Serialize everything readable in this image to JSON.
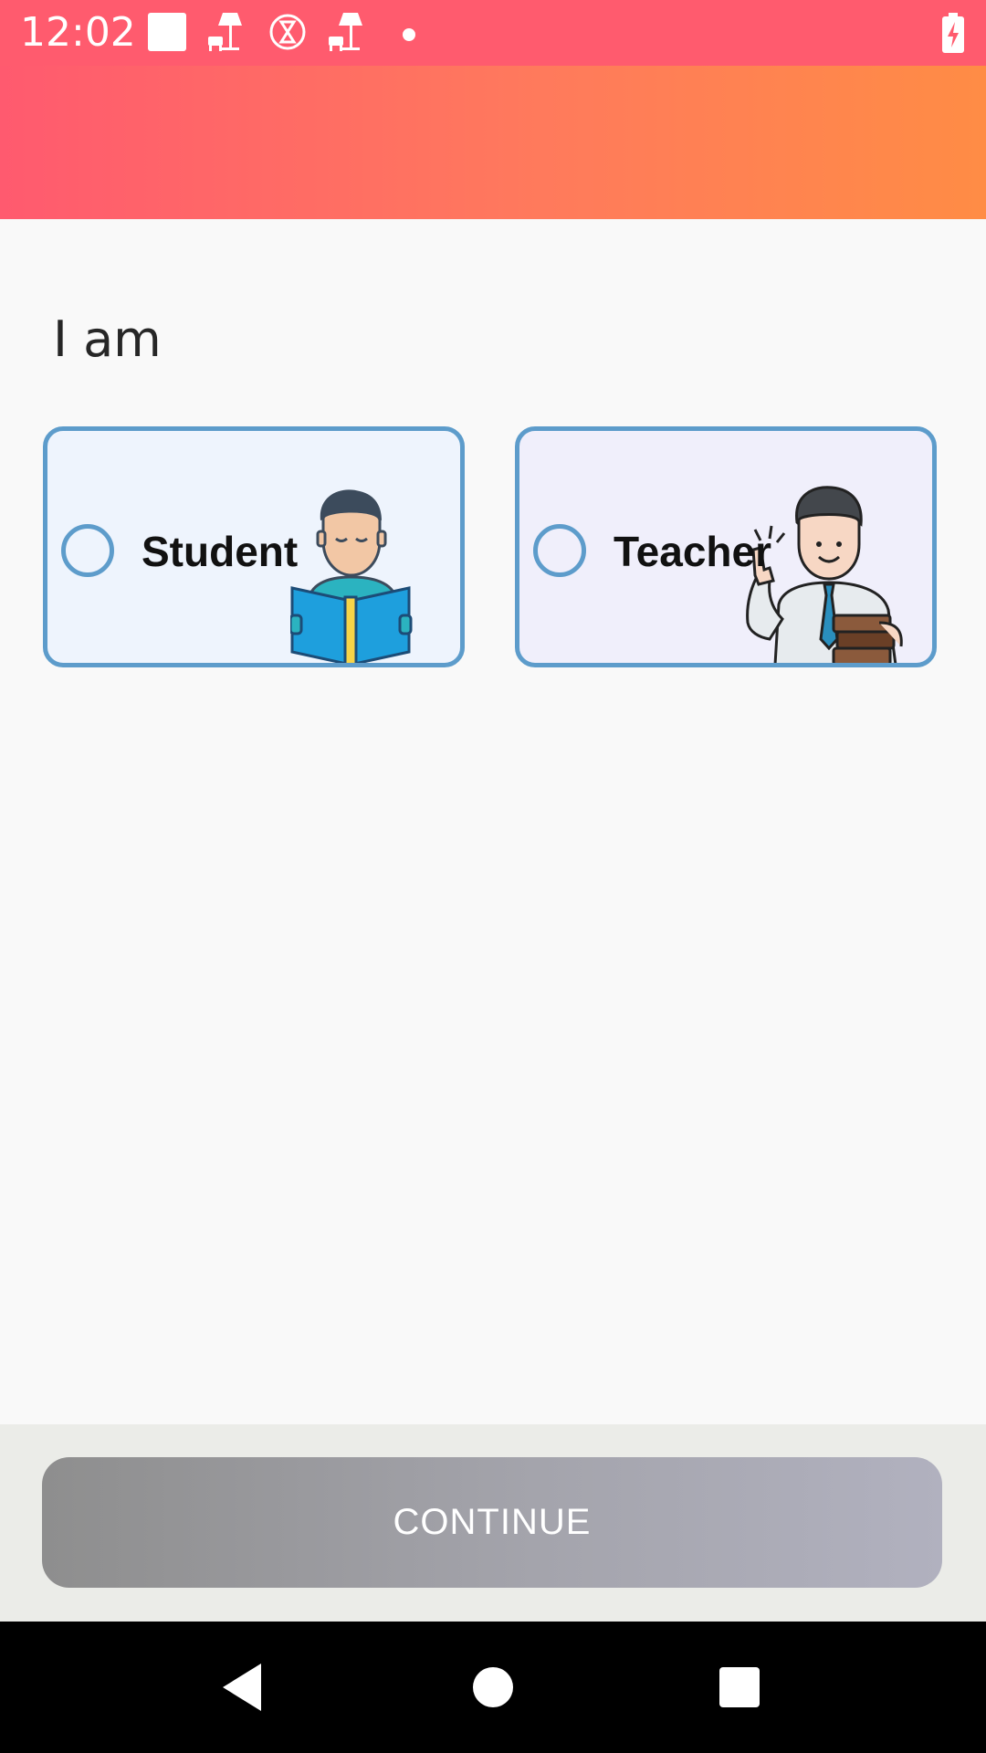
{
  "status_bar": {
    "time": "12:02",
    "icons": [
      "square-notification-icon",
      "lamp-icon",
      "hourglass-icon",
      "lamp-icon",
      "dot-icon",
      "battery-charging-icon"
    ]
  },
  "page": {
    "title": "I am"
  },
  "options": [
    {
      "label": "Student",
      "selected": false,
      "icon": "student-reading-illustration"
    },
    {
      "label": "Teacher",
      "selected": false,
      "icon": "teacher-illustration"
    }
  ],
  "footer": {
    "continue_label": "CONTINUE"
  },
  "colors": {
    "accent_start": "#ff5a6f",
    "accent_end": "#ff8c45",
    "card_border": "#5d9ccb",
    "button_disabled": "#a4a4ac"
  },
  "navigation": [
    "back-icon",
    "home-icon",
    "recents-icon"
  ]
}
